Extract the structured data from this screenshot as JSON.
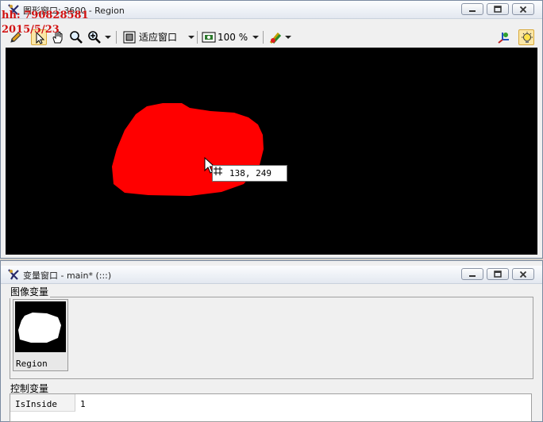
{
  "graphics_window": {
    "title": "图形窗口: 3600 - Region",
    "zoom_mode": "适应窗口",
    "zoom_percent": "100 %"
  },
  "cursor_coord": {
    "text": "138, 249"
  },
  "watermark": {
    "line1": "hh: 790828581",
    "line2": "2015/5/23"
  },
  "variable_window": {
    "title": "变量窗口 - main* (:::)",
    "iconic_group_title": "图像变量",
    "control_group_title": "控制变量",
    "iconic_variables": [
      {
        "name": "Region"
      }
    ],
    "control_variables": [
      {
        "name": "IsInside",
        "value": "1"
      }
    ]
  },
  "colors": {
    "region": "#ff0000",
    "canvas_background": "#000000",
    "watermark": "#d01010"
  }
}
